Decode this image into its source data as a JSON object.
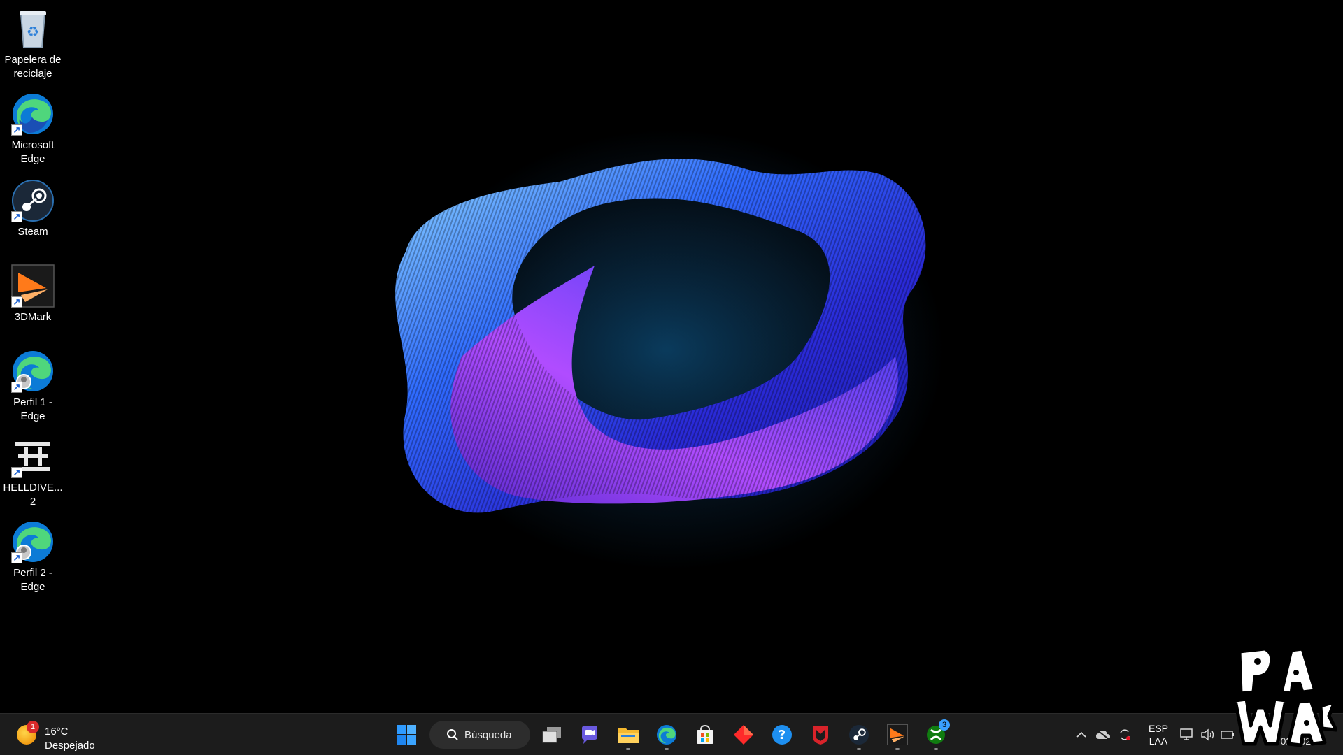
{
  "desktop": {
    "icons": [
      {
        "label": "Papelera de reciclaje",
        "icon": "recycle-bin-icon",
        "shortcut": false
      },
      {
        "label": "Microsoft Edge",
        "icon": "edge-icon",
        "shortcut": true
      },
      {
        "label": "Steam",
        "icon": "steam-icon",
        "shortcut": true
      },
      {
        "label": "3DMark",
        "icon": "3dmark-icon",
        "shortcut": true
      },
      {
        "label": "Perfil 1 - Edge",
        "icon": "edge-profile-icon",
        "shortcut": true
      },
      {
        "label": "HELLDIVE... 2",
        "icon": "helldivers-icon",
        "shortcut": true
      },
      {
        "label": "Perfil 2 - Edge",
        "icon": "edge-profile-icon",
        "shortcut": true
      }
    ]
  },
  "taskbar": {
    "weather": {
      "temp": "16°C",
      "condition": "Despejado",
      "badge": "1"
    },
    "search": {
      "label": "Búsqueda"
    },
    "apps": [
      {
        "name": "start",
        "icon": "windows-start-icon"
      },
      {
        "name": "task-view",
        "icon": "task-view-icon"
      },
      {
        "name": "teams",
        "icon": "teams-chat-icon"
      },
      {
        "name": "file-explorer",
        "icon": "folder-icon",
        "running": true
      },
      {
        "name": "edge",
        "icon": "edge-icon",
        "running": true
      },
      {
        "name": "store",
        "icon": "store-icon"
      },
      {
        "name": "app-red-diamond",
        "icon": "red-diamond-icon"
      },
      {
        "name": "help",
        "icon": "help-icon"
      },
      {
        "name": "mcafee",
        "icon": "mcafee-icon"
      },
      {
        "name": "steam",
        "icon": "steam-icon",
        "running": true
      },
      {
        "name": "3dmark",
        "icon": "3dmark-icon",
        "running": true
      },
      {
        "name": "xbox",
        "icon": "xbox-icon",
        "running": true,
        "badge": "3"
      }
    ],
    "tray": {
      "lang_top": "ESP",
      "lang_bottom": "LAA",
      "date": "26-02-2024"
    }
  },
  "colors": {
    "taskbar_bg": "#1c1c1c",
    "accent_blue": "#2b7fd9",
    "wallpaper_purple": "#7a3cff"
  }
}
